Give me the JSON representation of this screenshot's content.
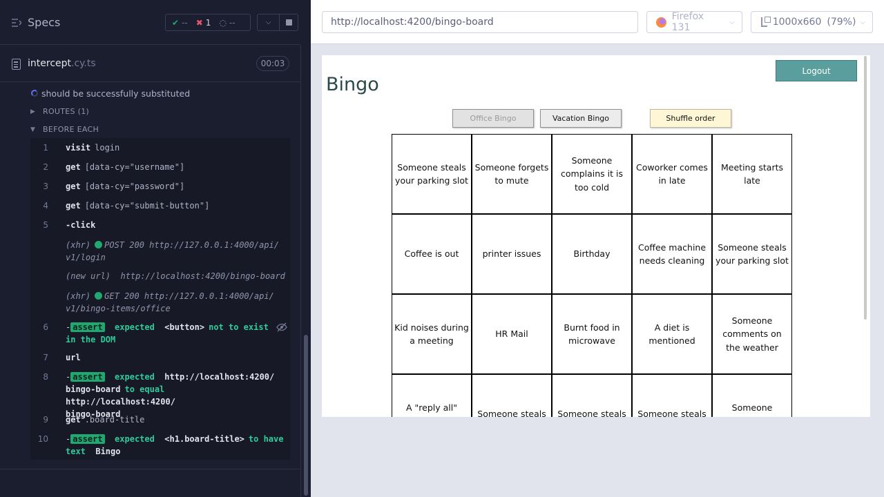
{
  "reporter": {
    "header": {
      "title": "Specs",
      "stats": {
        "passed": "--",
        "failed": "1",
        "pending": "--"
      }
    },
    "spec": {
      "name": "intercept",
      "ext": ".cy.ts",
      "duration": "00:03"
    },
    "test": {
      "title": "should be successfully substituted"
    },
    "sections": {
      "routes": "ROUTES (1)",
      "before_each": "BEFORE EACH"
    },
    "commands": [
      {
        "num": "1",
        "name": "visit",
        "message": "login"
      },
      {
        "num": "2",
        "name": "get",
        "message": "[data-cy=\"username\"]"
      },
      {
        "num": "3",
        "name": "get",
        "message": "[data-cy=\"password\"]"
      },
      {
        "num": "4",
        "name": "get",
        "message": "[data-cy=\"submit-button\"]"
      },
      {
        "num": "5",
        "name": "-click",
        "message": ""
      },
      {
        "kind": "(xhr)",
        "line1": "POST 200 http://127.0.0.1:4000/api/",
        "line2": "v1/login"
      },
      {
        "kind": "(new url)",
        "line1": "http://localhost:4200/bingo-board"
      },
      {
        "kind": "(xhr)",
        "line1": "GET 200 http://127.0.0.1:4000/api/",
        "line2": "v1/bingo-items/office"
      },
      {
        "num": "6",
        "badge": "assert",
        "a": "expected",
        "b": "<button>",
        "c": "not to exist",
        "d": "in the DOM"
      },
      {
        "num": "7",
        "name": "url",
        "message": ""
      },
      {
        "num": "8",
        "badge": "assert",
        "a": "expected",
        "b": "http://localhost:4200/",
        "c": "bingo-board",
        "d": "to equal",
        "e": "http://localhost:4200/",
        "f": "bingo-board"
      },
      {
        "num": "9",
        "name": "get",
        "message": ".board-title"
      },
      {
        "num": "10",
        "badge": "assert",
        "a": "expected",
        "b": "<h1.board-title>",
        "c": "to have",
        "d": "text",
        "e": "Bingo"
      }
    ]
  },
  "browser": {
    "url": "http://localhost:4200/bingo-board",
    "browser_name": "Firefox 131",
    "viewport_size": "1000x660",
    "zoom": "(79%)"
  },
  "app": {
    "logout_label": "Logout",
    "title": "Bingo",
    "buttons": {
      "office": "Office Bingo",
      "vacation": "Vacation Bingo",
      "shuffle": "Shuffle order"
    },
    "cells": [
      "Someone steals your parking slot",
      "Someone forgets to mute",
      "Someone complains it is too cold",
      "Coworker comes in late",
      "Meeting starts late",
      "Coffee is out",
      "printer issues",
      "Birthday",
      "Coffee machine needs cleaning",
      "Someone steals your parking slot",
      "Kid noises during a meeting",
      "HR Mail",
      "Burnt food in microwave",
      "A diet is mentioned",
      "Someone comments on the weather",
      "A \"reply all\" email",
      "Someone steals",
      "Someone steals",
      "Someone steals",
      "Someone complains it is"
    ]
  },
  "colors": {
    "reporter_bg": "#1b1e2e",
    "pass": "#1fa971",
    "fail": "#e45770",
    "logout_bg": "#5b9e9e",
    "shuffle_bg": "#fff6d5"
  }
}
